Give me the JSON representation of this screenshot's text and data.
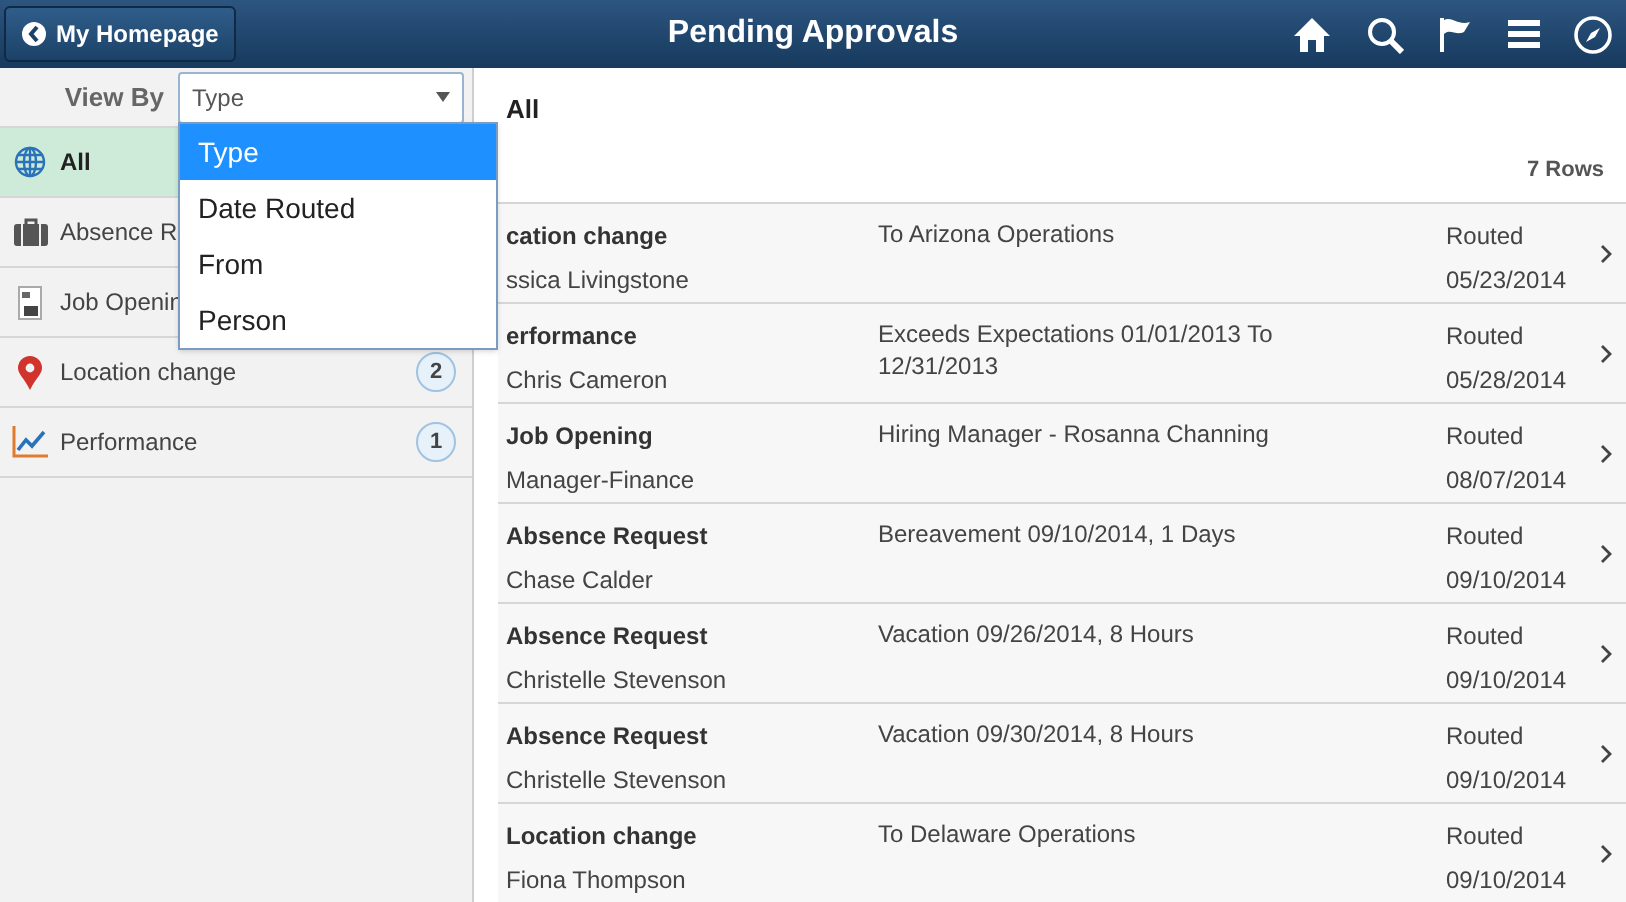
{
  "header": {
    "back_button": "My Homepage",
    "title": "Pending Approvals"
  },
  "view_by": {
    "label": "View By",
    "value": "Type",
    "options": [
      {
        "label": "Type",
        "selected": true
      },
      {
        "label": "Date Routed",
        "selected": false
      },
      {
        "label": "From",
        "selected": false
      },
      {
        "label": "Person",
        "selected": false
      }
    ]
  },
  "sidebar": {
    "items": [
      {
        "kind": "globe",
        "label": "All",
        "selected": true
      },
      {
        "kind": "briefcase",
        "label": "Absence R",
        "selected": false
      },
      {
        "kind": "document",
        "label": "Job Openin",
        "selected": false
      },
      {
        "kind": "pin",
        "label": "Location change",
        "count": "2",
        "selected": false
      },
      {
        "kind": "chart",
        "label": "Performance",
        "count": "1",
        "selected": false
      }
    ]
  },
  "main": {
    "title": "All",
    "row_count": "7 Rows",
    "rows": [
      {
        "type": "cation change",
        "person": "ssica Livingstone",
        "detail": "To Arizona Operations",
        "status": "Routed",
        "date": "05/23/2014"
      },
      {
        "type": "erformance",
        "person": "Chris Cameron",
        "detail": "Exceeds Expectations 01/01/2013 To 12/31/2013",
        "status": "Routed",
        "date": "05/28/2014"
      },
      {
        "type": "Job Opening",
        "person": "Manager-Finance",
        "detail": "Hiring Manager - Rosanna Channing",
        "status": "Routed",
        "date": "08/07/2014"
      },
      {
        "type": "Absence Request",
        "person": "Chase Calder",
        "detail": "Bereavement 09/10/2014, 1 Days",
        "status": "Routed",
        "date": "09/10/2014"
      },
      {
        "type": "Absence Request",
        "person": "Christelle Stevenson",
        "detail": "Vacation 09/26/2014, 8 Hours",
        "status": "Routed",
        "date": "09/10/2014"
      },
      {
        "type": "Absence Request",
        "person": "Christelle Stevenson",
        "detail": "Vacation 09/30/2014, 8 Hours",
        "status": "Routed",
        "date": "09/10/2014"
      },
      {
        "type": "Location change",
        "person": "Fiona Thompson",
        "detail": "To Delaware Operations",
        "status": "Routed",
        "date": "09/10/2014"
      }
    ]
  }
}
